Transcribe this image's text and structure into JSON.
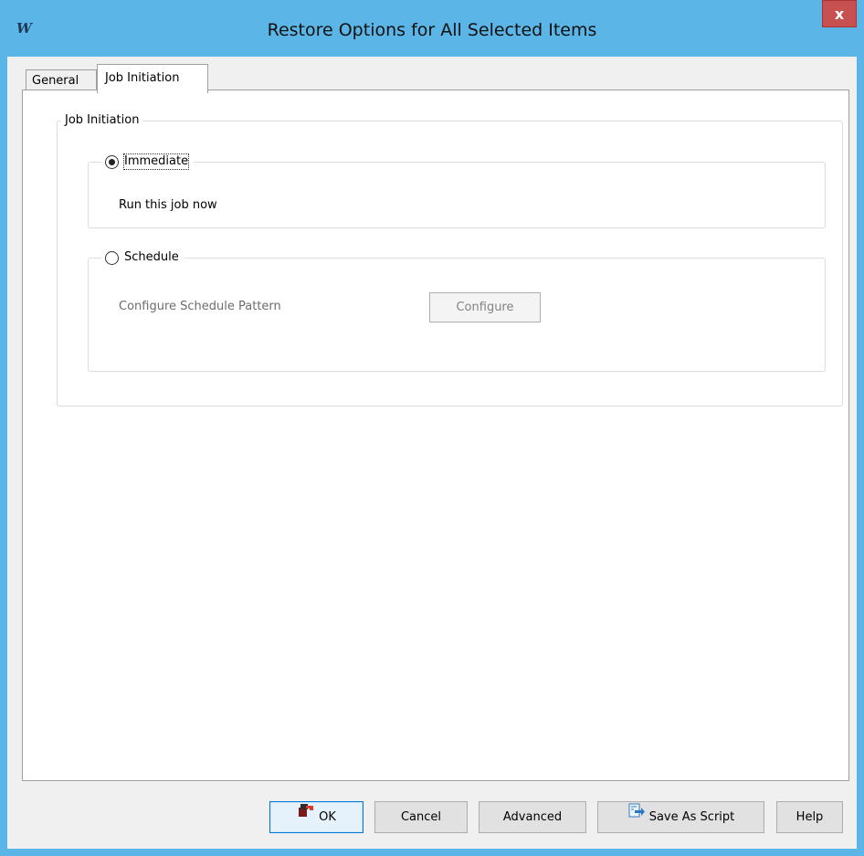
{
  "window": {
    "title": "Restore Options for All Selected Items",
    "app_icon_glyph": "W",
    "close_glyph": "x"
  },
  "tabs": [
    {
      "label": "General",
      "active": false
    },
    {
      "label": "Job Initiation",
      "active": true
    }
  ],
  "job_initiation": {
    "group_label": "Job Initiation",
    "immediate": {
      "label": "Immediate",
      "checked": true,
      "description": "Run this job now"
    },
    "schedule": {
      "label": "Schedule",
      "checked": false,
      "pattern_label": "Configure Schedule Pattern",
      "configure_button": "Configure"
    }
  },
  "buttons": {
    "ok": "OK",
    "cancel": "Cancel",
    "advanced": "Advanced",
    "save_as_script": "Save As Script",
    "help": "Help"
  },
  "colors": {
    "frame": "#5bb5e6",
    "close": "#c75050",
    "primary_border": "#0078d7"
  }
}
